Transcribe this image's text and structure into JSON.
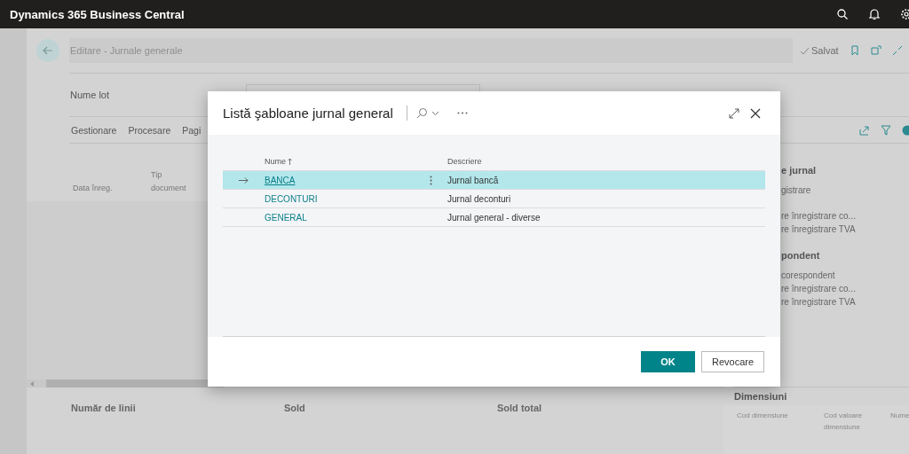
{
  "app_bar": {
    "title": "Dynamics 365 Business Central"
  },
  "page": {
    "title": "Editare - Jurnale generale",
    "status": "Salvat",
    "field_label": "Nume lot",
    "actions": [
      "Gestionare",
      "Procesare",
      "Pagi"
    ],
    "columns": [
      "Data înreg.",
      "Tip document"
    ],
    "totals": [
      "Număr de linii",
      "Sold",
      "Sold total"
    ]
  },
  "factbox": {
    "groups": [
      {
        "heading": "e jurnal",
        "lines": [
          "gistrare"
        ]
      },
      {
        "lines": [
          "re înregistrare co...",
          "re înregistrare TVA"
        ]
      },
      {
        "heading": "pondent",
        "lines": [
          "corespondent",
          "re înregistrare co...",
          "re înregistrare TVA"
        ]
      }
    ],
    "dimensions": {
      "title": "Dimensiuni",
      "columns": [
        "Cod dimensiune",
        "Cod valoare dimensiune",
        "Nume"
      ]
    }
  },
  "dialog": {
    "title": "Listă şabloane jurnal general",
    "columns": [
      "Nume",
      "Descriere"
    ],
    "rows": [
      {
        "name": "BANCA",
        "description": "Jurnal bancă",
        "selected": true
      },
      {
        "name": "DECONTURI",
        "description": "Jurnal deconturi",
        "selected": false
      },
      {
        "name": "GENERAL",
        "description": "Jurnal general - diverse",
        "selected": false
      }
    ],
    "buttons": [
      {
        "label": "OK",
        "kind": "primary"
      },
      {
        "label": "Revocare",
        "kind": "secondary"
      }
    ]
  }
}
